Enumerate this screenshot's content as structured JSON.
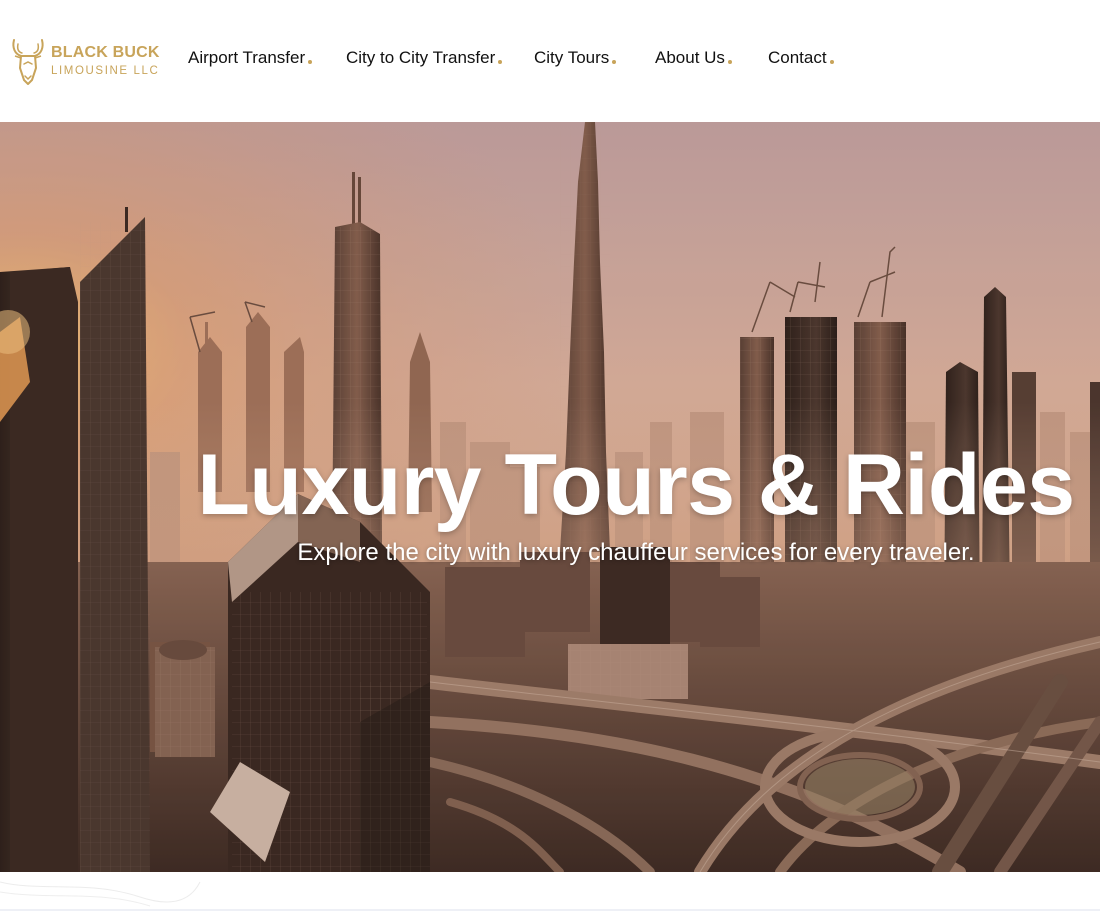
{
  "brand": {
    "name_line1": "BLACK BUCK",
    "name_line2": "LIMOUSINE LLC",
    "logo_icon": "buck-head-icon",
    "accent_color": "#c8a45a"
  },
  "nav": {
    "items": [
      {
        "label": "Airport Transfer"
      },
      {
        "label": "City to City Transfer"
      },
      {
        "label": "City Tours"
      },
      {
        "label": "About Us"
      },
      {
        "label": "Contact"
      }
    ],
    "dot_color": "#c8a45a"
  },
  "hero": {
    "title": "Luxury Tours & Rides",
    "subtitle": "Explore the city with luxury chauffeur services for every traveler.",
    "background": "city-skyline-image"
  }
}
